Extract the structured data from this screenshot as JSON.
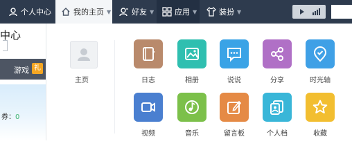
{
  "nav": {
    "items": [
      {
        "label": "个人中心",
        "icon": "person-icon"
      },
      {
        "label": "我的主页",
        "icon": "home-icon"
      },
      {
        "label": "好友",
        "icon": "friends-icon"
      },
      {
        "label": "应用",
        "icon": "grid-icon"
      },
      {
        "label": "装扮",
        "icon": "shirt-icon"
      }
    ]
  },
  "left": {
    "center_title": "中心",
    "game_label": "游戏",
    "game_badge": "礼",
    "score_label": "券：",
    "score_value": "0"
  },
  "panel": {
    "home_label": "主页",
    "apps": [
      {
        "label": "日志",
        "icon": "diary-icon",
        "color": "#b98a6c"
      },
      {
        "label": "相册",
        "icon": "photo-icon",
        "color": "#2fbfb0"
      },
      {
        "label": "说说",
        "icon": "chat-icon",
        "color": "#3aa3e6"
      },
      {
        "label": "分享",
        "icon": "share-icon",
        "color": "#b070c6"
      },
      {
        "label": "时光轴",
        "icon": "timeline-icon",
        "color": "#3fa0e6"
      },
      {
        "label": "视频",
        "icon": "video-icon",
        "color": "#4a7fd0"
      },
      {
        "label": "音乐",
        "icon": "music-icon",
        "color": "#7cc04a"
      },
      {
        "label": "留言板",
        "icon": "message-board-icon",
        "color": "#e58a45"
      },
      {
        "label": "个人档",
        "icon": "profile-icon",
        "color": "#39b6d8"
      },
      {
        "label": "收藏",
        "icon": "star-icon",
        "color": "#f2be30"
      }
    ]
  }
}
